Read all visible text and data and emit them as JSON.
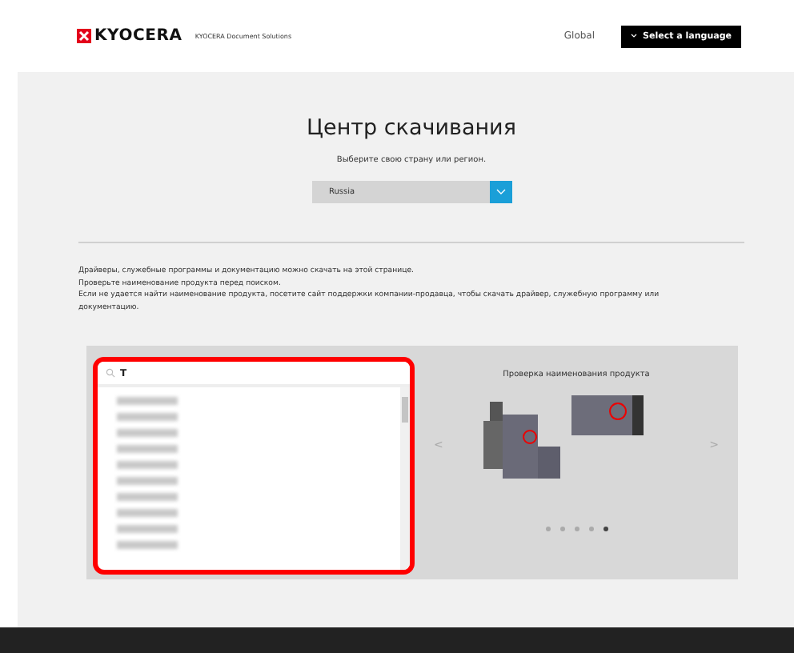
{
  "header": {
    "logo": "KYOCERA",
    "company": "KYOCERA Document Solutions",
    "region": "Global",
    "language_button": "Select a language"
  },
  "title": "Центр скачивания",
  "subtitle": "Выберите свою страну или регион.",
  "country_select": {
    "value": "Russia"
  },
  "intro": [
    "Драйверы, служебные программы и документацию можно скачать на этой странице.",
    "Проверьте наименование продукта перед поиском.",
    "Если не удается найти наименование продукта, посетите сайт поддержки компании-продавца, чтобы скачать драйвер, служебную программу или документацию."
  ],
  "search": {
    "value": "T",
    "results": [
      {
        "kind": "blurred"
      },
      {
        "kind": "blurred"
      },
      {
        "kind": "blurred"
      },
      {
        "kind": "blurred"
      },
      {
        "kind": "blurred"
      },
      {
        "kind": "blurred"
      },
      {
        "kind": "blurred"
      },
      {
        "kind": "blurred"
      },
      {
        "kind": "blurred"
      },
      {
        "kind": "blurred"
      }
    ]
  },
  "carousel": {
    "title": "Проверка наименования продукта",
    "prev": "<",
    "next": ">",
    "dots": [
      {
        "selected": false
      },
      {
        "selected": false
      },
      {
        "selected": false
      },
      {
        "selected": false
      },
      {
        "selected": true
      }
    ]
  }
}
